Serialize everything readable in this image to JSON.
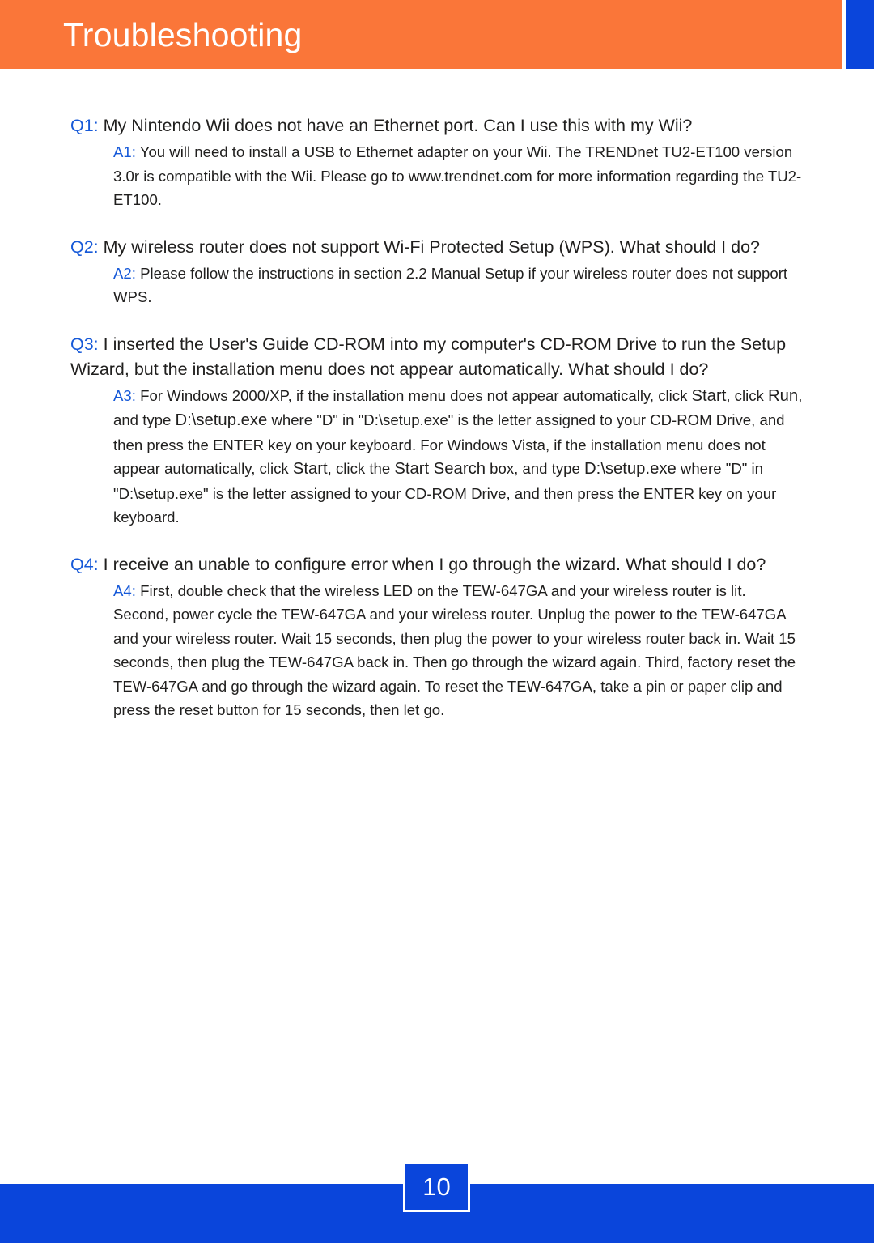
{
  "header": {
    "title": "Troubleshooting",
    "band_color": "#fa7639",
    "accent_color": "#0a45db",
    "title_color": "#ffffff"
  },
  "theme": {
    "label_blue": "#1659d8",
    "body_text": "#201f1e",
    "orange": "#fa7639",
    "blue": "#0a45db"
  },
  "faq": [
    {
      "q_label": "Q1:",
      "q_text": " My Nintendo Wii does not have an Ethernet port.  Can I use this with my Wii?",
      "a_label": "A1:",
      "a_text": " You will need to install a USB to Ethernet adapter on your Wii.  The TRENDnet TU2-ET100 version 3.0r is compatible with the Wii.  Please go to www.trendnet.com for more information regarding the TU2-ET100."
    },
    {
      "q_label": "Q2:",
      "q_text": " My wireless router does not support Wi-Fi Protected Setup (WPS).  What should I do?",
      "a_label": "A2:",
      "a_text": " Please follow the instructions in section 2.2 Manual Setup if your wireless router does not support WPS."
    },
    {
      "q_label": "Q3:",
      "q_text": " I inserted the User's Guide CD-ROM into my computer's CD-ROM Drive to run the Setup Wizard, but the installation menu does not appear automatically. What should I do?",
      "a_label": "A3:",
      "a_part1": " For Windows 2000/XP, if the installation menu does not appear automatically, click ",
      "a_term1": "Start",
      "a_part2": ", click ",
      "a_term2": "Run",
      "a_part3": ", and type ",
      "a_term3": "D:\\setup.exe",
      "a_part4": " where \"D\" in \"D:\\setup.exe\" is the letter assigned to your CD-ROM Drive, and then press the ENTER key on your keyboard. For Windows Vista, if the installation menu does not appear automatically, click ",
      "a_term4": "Start",
      "a_part5": ", click the ",
      "a_term5": "Start Search",
      "a_part6": " box, and type ",
      "a_term6": "D:\\setup.exe",
      "a_part7": " where \"D\" in \"D:\\setup.exe\" is the letter assigned to your CD-ROM Drive, and then press the ENTER key on your  keyboard."
    },
    {
      "q_label": "Q4:",
      "q_text": " I receive an unable to configure error when I go through the wizard.  What should I do?",
      "a_label": "A4:",
      "a_text": " First, double check that the wireless LED on the TEW-647GA and your wireless router is lit.  Second, power cycle the TEW-647GA and your wireless router.  Unplug the power to the TEW-647GA and your wireless router.  Wait 15 seconds, then plug the power to your wireless router back in.  Wait 15 seconds, then plug the TEW-647GA back in.  Then go through the wizard again.  Third, factory reset the TEW-647GA and go through the wizard again.  To reset the TEW-647GA, take a pin or paper clip and press the reset button for 15 seconds, then let go."
    }
  ],
  "footer": {
    "page_number": "10",
    "bar_color": "#0a45db"
  }
}
